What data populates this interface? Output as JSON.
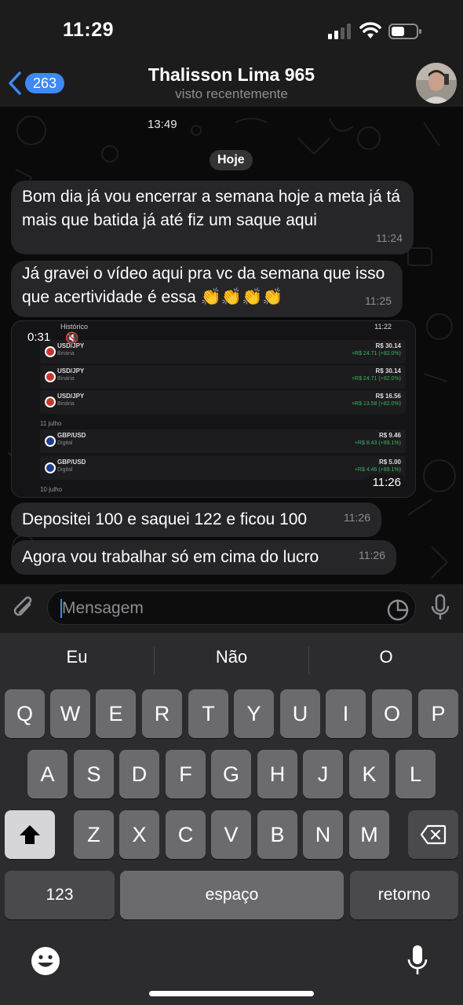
{
  "status": {
    "time": "11:29"
  },
  "header": {
    "back_count": "263",
    "title": "Thalisson Lima 965",
    "subtitle": "visto recentemente"
  },
  "chat": {
    "top_timestamp": "13:49",
    "date_label": "Hoje",
    "messages": [
      {
        "text": "Bom dia já vou encerrar a semana hoje a meta já tá mais que batida já até fiz um saque aqui",
        "time": "11:24"
      },
      {
        "text": "Já gravei o vídeo aqui pra vc da semana que isso que acertividade é essa 👏👏👏👏",
        "time": "11:25"
      },
      {
        "text": "Depositei 100 e saquei 122 e ficou 100",
        "time": "11:26"
      },
      {
        "text": "Agora vou trabalhar só em cima do lucro",
        "time": "11:26"
      }
    ],
    "video": {
      "duration": "0:31",
      "time": "11:26",
      "inner_status_time": "11:22",
      "inner_title": "Histórico",
      "trades": [
        {
          "pair": "USD/JPY",
          "kind": "Binária",
          "amount": "R$ 30.14",
          "gain": "+R$ 24.71 (+82.0%)"
        },
        {
          "pair": "USD/JPY",
          "kind": "Binária",
          "amount": "R$ 30.14",
          "gain": "+R$ 24.71 (+82.0%)"
        },
        {
          "pair": "USD/JPY",
          "kind": "Binária",
          "amount": "R$ 16.56",
          "gain": "+R$ 13.58 (+82.0%)"
        },
        {
          "pair": "GBP/USD",
          "kind": "Digital",
          "amount": "R$ 9.46",
          "gain": "+R$ 8.43 (+89.1%)"
        },
        {
          "pair": "GBP/USD",
          "kind": "Digital",
          "amount": "R$ 5.00",
          "gain": "+R$ 4.46 (+89.1%)"
        }
      ],
      "date_labels": [
        "11 julho",
        "10 julho"
      ]
    }
  },
  "composer": {
    "placeholder": "Mensagem"
  },
  "keyboard": {
    "suggestions": [
      "Eu",
      "Não",
      "O"
    ],
    "row1": [
      "Q",
      "W",
      "E",
      "R",
      "T",
      "Y",
      "U",
      "I",
      "O",
      "P"
    ],
    "row2": [
      "A",
      "S",
      "D",
      "F",
      "G",
      "H",
      "J",
      "K",
      "L"
    ],
    "row3": [
      "Z",
      "X",
      "C",
      "V",
      "B",
      "N",
      "M"
    ],
    "numbers_label": "123",
    "space_label": "espaço",
    "return_label": "retorno"
  },
  "colors": {
    "accent": "#3e88f7",
    "bubble": "#262628",
    "keyboard_bg": "#2c2c2e",
    "key": "#6b6b6e"
  }
}
